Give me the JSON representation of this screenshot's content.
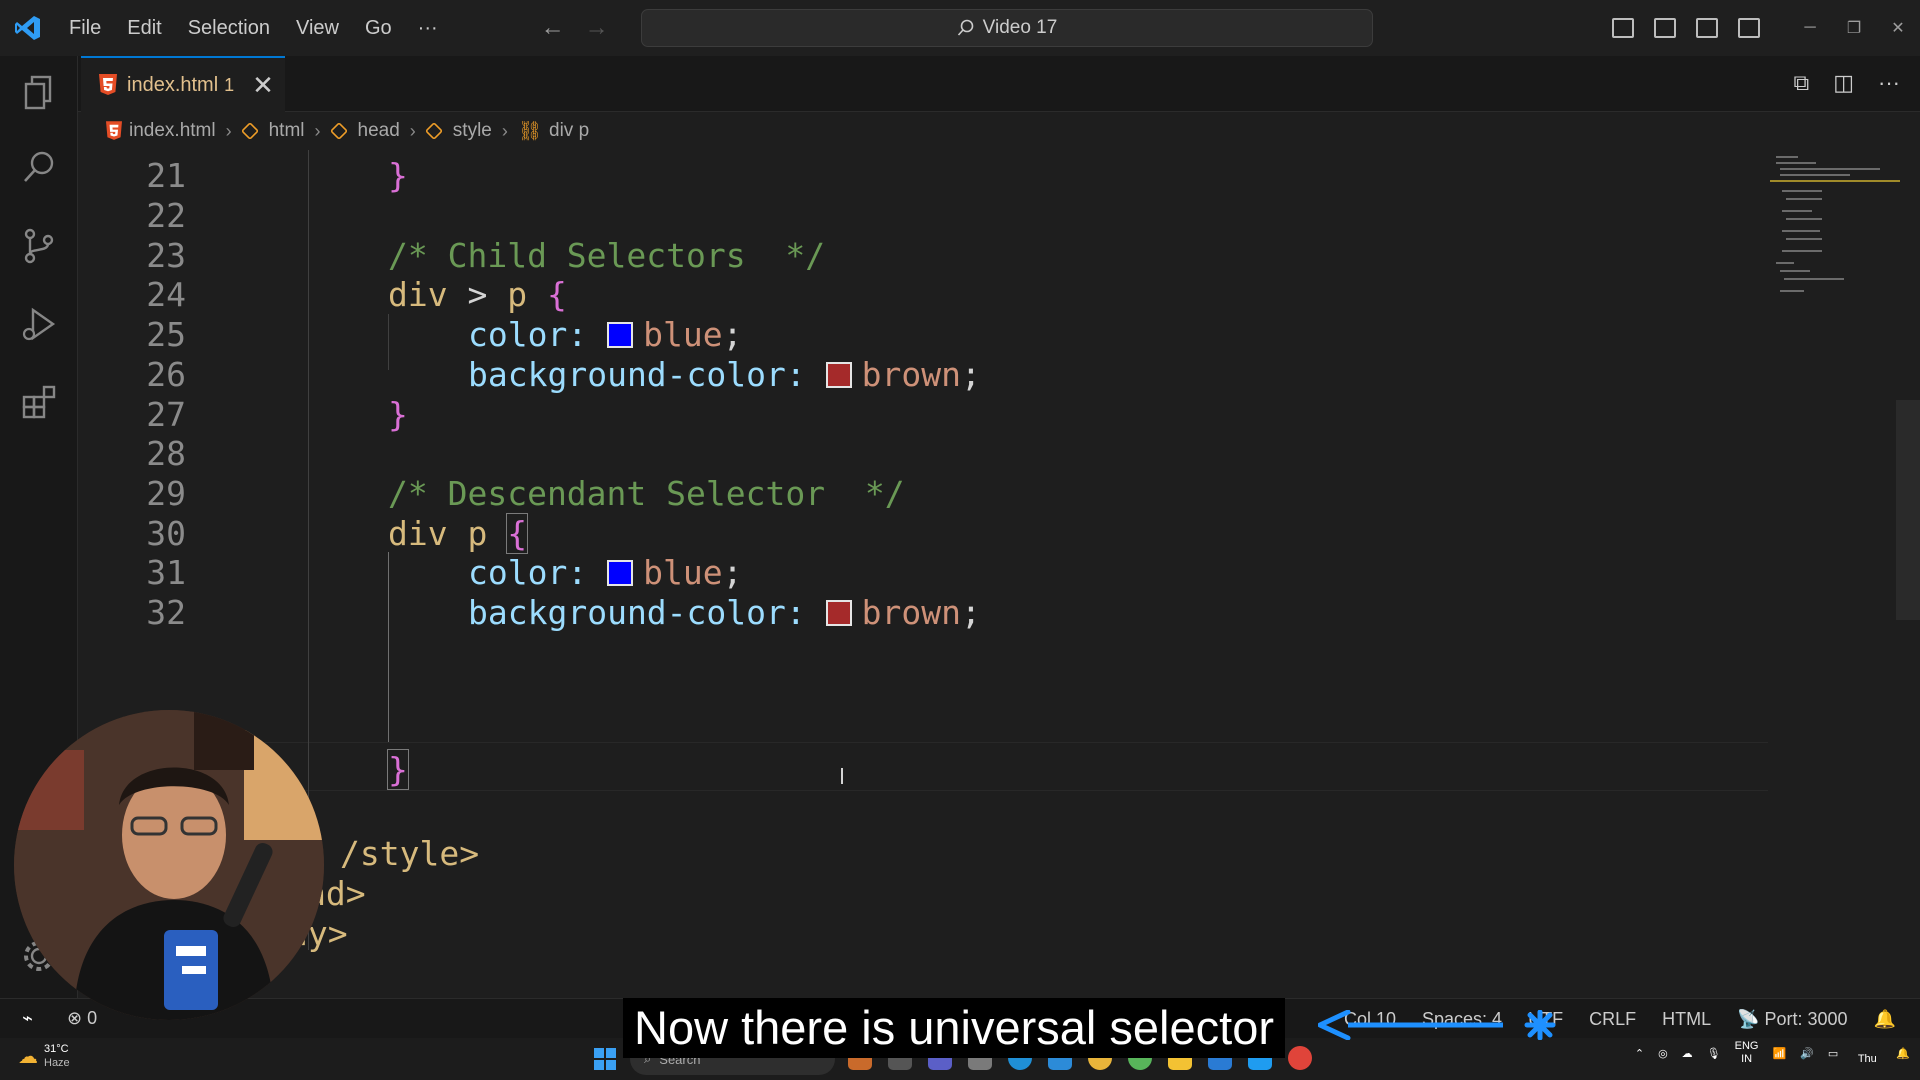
{
  "menu": {
    "items": [
      "File",
      "Edit",
      "Selection",
      "View",
      "Go",
      "···"
    ]
  },
  "command_center": {
    "text": "Video 17"
  },
  "tab": {
    "name": "index.html",
    "problems": "1",
    "close": "✕"
  },
  "breadcrumb": {
    "items": [
      "index.html",
      "html",
      "head",
      "style",
      "div p"
    ]
  },
  "editor": {
    "lines": [
      {
        "num": "21"
      },
      {
        "num": "22"
      },
      {
        "num": "23"
      },
      {
        "num": "24"
      },
      {
        "num": "25"
      },
      {
        "num": "26"
      },
      {
        "num": "27"
      },
      {
        "num": "28"
      },
      {
        "num": "29"
      },
      {
        "num": "30"
      },
      {
        "num": "31"
      },
      {
        "num": "32"
      }
    ],
    "code": {
      "l21": "}",
      "l23": "/* Child Selectors  */",
      "l24_sel1": "div",
      "l24_op": ">",
      "l24_sel2": "p",
      "l24_brace": "{",
      "color_prop": "color:",
      "blue_val": "blue",
      "bg_prop": "background-color:",
      "brown_val": "brown",
      "semi": ";",
      "close_brace": "}",
      "l29": "/* Descendant Selector  */",
      "l30_sel": "div p",
      "l30_brace": "{",
      "l34": "/style>",
      "l35": "ad>",
      "l36": "dy>"
    },
    "swatch_colors": {
      "blue": "#0000ff",
      "brown": "#a52a2a"
    }
  },
  "status": {
    "errors": "0",
    "ln_col": "Col 10",
    "spaces": "Spaces: 4",
    "encoding": "UTF",
    "eol": "CRLF",
    "language": "HTML",
    "port": "Port: 3000"
  },
  "taskbar": {
    "weather_temp": "31°C",
    "weather_desc": "Haze",
    "search": "Search",
    "lang1": "ENG",
    "lang2": "IN",
    "day": "Thu"
  },
  "caption": {
    "text": "Now there is universal selector"
  }
}
